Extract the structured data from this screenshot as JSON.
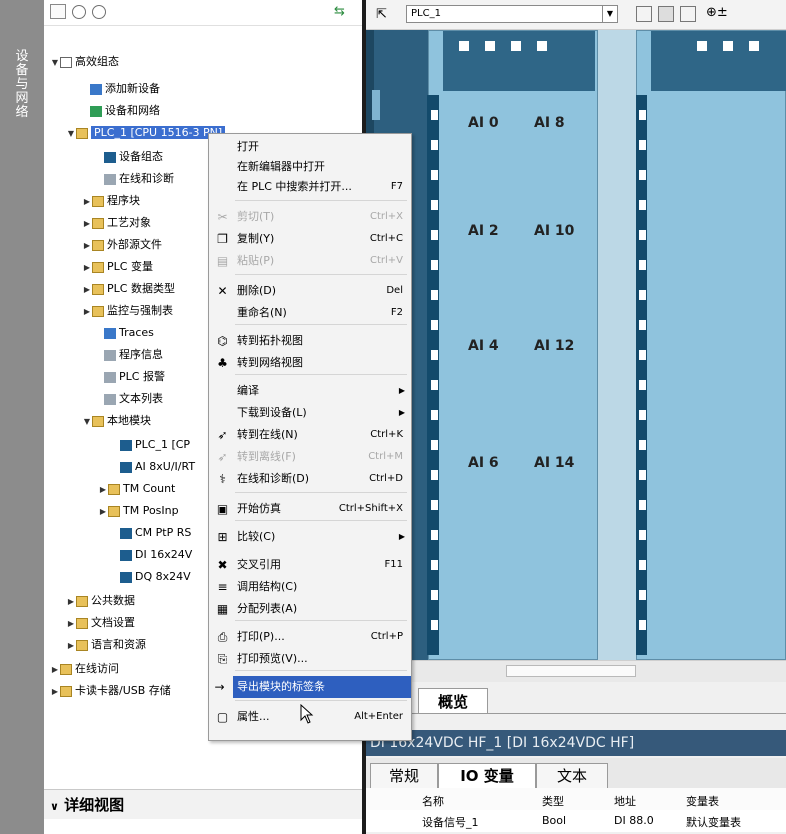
{
  "vertical_tab": "设备与网络",
  "tree": {
    "root": "高效组态",
    "items": [
      {
        "label": "添加新设备"
      },
      {
        "label": "设备和网络"
      },
      {
        "label": "PLC_1 [CPU 1516-3 PN]"
      },
      {
        "label": "设备组态"
      },
      {
        "label": "在线和诊断"
      },
      {
        "label": "程序块"
      },
      {
        "label": "工艺对象"
      },
      {
        "label": "外部源文件"
      },
      {
        "label": "PLC 变量"
      },
      {
        "label": "PLC 数据类型"
      },
      {
        "label": "监控与强制表"
      },
      {
        "label": "Traces"
      },
      {
        "label": "程序信息"
      },
      {
        "label": "PLC 报警"
      },
      {
        "label": "文本列表"
      },
      {
        "label": "本地模块"
      },
      {
        "label": "PLC_1 [CP"
      },
      {
        "label": "AI 8xU/I/RT"
      },
      {
        "label": "TM Count"
      },
      {
        "label": "TM PosInp"
      },
      {
        "label": "CM PtP RS"
      },
      {
        "label": "DI 16x24V"
      },
      {
        "label": "DQ 8x24V"
      },
      {
        "label": "公共数据"
      },
      {
        "label": "文档设置"
      },
      {
        "label": "语言和资源"
      },
      {
        "label": "在线访问"
      },
      {
        "label": "卡读卡器/USB 存储"
      }
    ],
    "detail_view": "详细视图"
  },
  "device_toolbar": {
    "device_select": "PLC_1"
  },
  "modules": {
    "ai_labels": [
      [
        "AI 0",
        "AI 8"
      ],
      [
        "AI 2",
        "AI 10"
      ],
      [
        "AI 4",
        "AI 12"
      ],
      [
        "AI 6",
        "AI 14"
      ]
    ]
  },
  "context_menu": {
    "items": [
      {
        "label": "打开",
        "shortcut": "",
        "icon": "",
        "disabled": false
      },
      {
        "label": "在新编辑器中打开",
        "shortcut": "",
        "icon": "",
        "disabled": false
      },
      {
        "label": "在 PLC 中搜索并打开...",
        "shortcut": "F7",
        "icon": "",
        "disabled": false
      },
      {
        "label": "剪切(T)",
        "shortcut": "Ctrl+X",
        "icon": "scissors-icon",
        "disabled": true
      },
      {
        "label": "复制(Y)",
        "shortcut": "Ctrl+C",
        "icon": "copy-icon",
        "disabled": false
      },
      {
        "label": "粘贴(P)",
        "shortcut": "Ctrl+V",
        "icon": "paste-icon",
        "disabled": true
      },
      {
        "label": "删除(D)",
        "shortcut": "Del",
        "icon": "delete-icon",
        "disabled": false
      },
      {
        "label": "重命名(N)",
        "shortcut": "F2",
        "icon": "",
        "disabled": false
      },
      {
        "label": "转到拓扑视图",
        "shortcut": "",
        "icon": "topology-icon",
        "disabled": false
      },
      {
        "label": "转到网络视图",
        "shortcut": "",
        "icon": "network-icon",
        "disabled": false
      },
      {
        "label": "编译",
        "shortcut": "",
        "icon": "",
        "disabled": false,
        "submenu": true
      },
      {
        "label": "下载到设备(L)",
        "shortcut": "",
        "icon": "",
        "disabled": false,
        "submenu": true
      },
      {
        "label": "转到在线(N)",
        "shortcut": "Ctrl+K",
        "icon": "go-online-icon",
        "disabled": false
      },
      {
        "label": "转到离线(F)",
        "shortcut": "Ctrl+M",
        "icon": "go-offline-icon",
        "disabled": true
      },
      {
        "label": "在线和诊断(D)",
        "shortcut": "Ctrl+D",
        "icon": "diagnostics-icon",
        "disabled": false
      },
      {
        "label": "开始仿真",
        "shortcut": "Ctrl+Shift+X",
        "icon": "simulation-icon",
        "disabled": false
      },
      {
        "label": "比较(C)",
        "shortcut": "",
        "icon": "compare-icon",
        "disabled": false,
        "submenu": true
      },
      {
        "label": "交叉引用",
        "shortcut": "F11",
        "icon": "cross-reference-icon",
        "disabled": false
      },
      {
        "label": "调用结构(C)",
        "shortcut": "",
        "icon": "call-structure-icon",
        "disabled": false
      },
      {
        "label": "分配列表(A)",
        "shortcut": "",
        "icon": "assignment-list-icon",
        "disabled": false
      },
      {
        "label": "打印(P)...",
        "shortcut": "Ctrl+P",
        "icon": "print-icon",
        "disabled": false
      },
      {
        "label": "打印预览(V)...",
        "shortcut": "",
        "icon": "print-preview-icon",
        "disabled": false
      },
      {
        "label": "导出模块的标签条",
        "shortcut": "",
        "icon": "export-icon",
        "disabled": false,
        "highlighted": true
      },
      {
        "label": "属性...",
        "shortcut": "Alt+Enter",
        "icon": "properties-icon",
        "disabled": false
      }
    ]
  },
  "overview_tab": "概览",
  "properties": {
    "title": "DI 16x24VDC HF_1 [DI 16x24VDC HF]",
    "tabs": [
      "常规",
      "IO 变量",
      "文本"
    ],
    "columns": [
      "名称",
      "类型",
      "地址",
      "变量表"
    ],
    "rows": [
      {
        "name": "设备信号_1",
        "type": "Bool",
        "address": "DI 88.0",
        "table": "默认变量表"
      }
    ]
  }
}
